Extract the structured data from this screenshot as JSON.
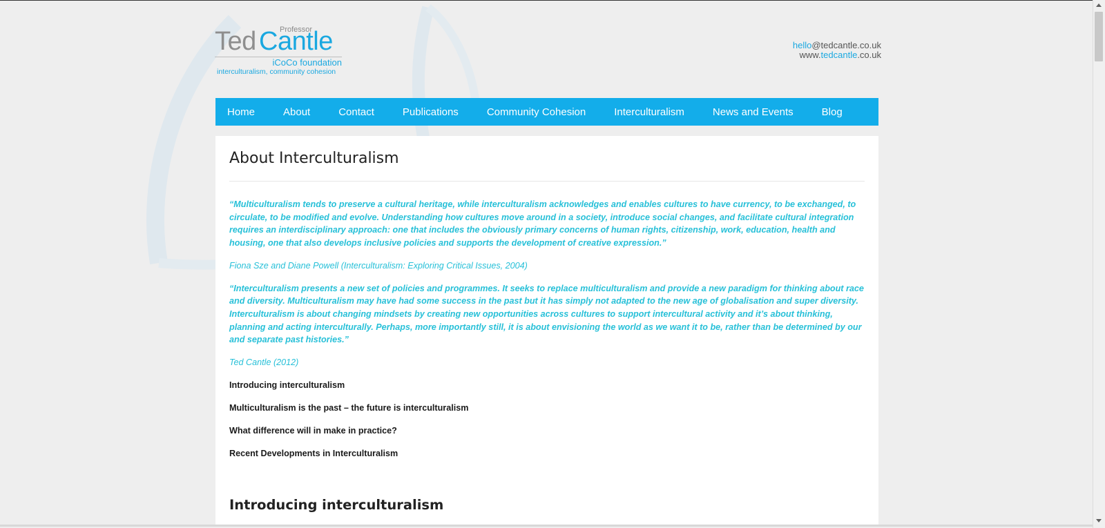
{
  "header": {
    "logo": {
      "professor": "Professor",
      "ted": "Ted",
      "cantle": "Cantle",
      "foundation": "iCoCo foundation",
      "tagline": "interculturalism, community cohesion"
    },
    "contact": {
      "email_user": "hello",
      "email_domain": "@tedcantle.co.uk",
      "web_prefix": "www.",
      "web_name": "tedcantle",
      "web_suffix": ".co.uk"
    }
  },
  "nav": {
    "items": [
      "Home",
      "About",
      "Contact",
      "Publications",
      "Community Cohesion",
      "Interculturalism",
      "News and Events",
      "Blog"
    ]
  },
  "main": {
    "title": "About Interculturalism",
    "quote1": "“Multiculturalism tends to preserve a cultural heritage, while interculturalism acknowledges and enables cultures to have currency, to be exchanged, to circulate, to be modified and evolve. Understanding how cultures move around in a society, introduce social changes, and facilitate cultural integration requires an interdisciplinary approach: one that includes the obviously primary concerns of human rights, citizenship, work, education, health and housing, one that also develops inclusive policies and supports the development of creative expression.”",
    "cite1": "Fiona Sze and Diane Powell (Interculturalism: Exploring Critical Issues, 2004)",
    "quote2": "“Interculturalism  presents a new set of policies and programmes. It seeks to replace  multiculturalism and provide a new paradigm for thinking about race and diversity. Multiculturalism may have had some success in the past but it has simply not adapted to the new age of globalisation and super diversity. Interculturalism is about changing mindsets by creating new opportunities across cultures to support intercultural activity and it’s about thinking, planning and acting interculturally. Perhaps, more importantly still, it is about envisioning the world as we want it to be, rather than be determined by our and separate past histories.”",
    "cite2": "Ted Cantle (2012)",
    "links": [
      "Introducing interculturalism",
      "Multiculturalism is the past – the future is interculturalism",
      "What difference will in make in practice?",
      "Recent Developments in Interculturalism"
    ],
    "section_title": "Introducing interculturalism"
  },
  "colors": {
    "accent": "#13adea",
    "quote": "#27c0d8",
    "background": "#eeeeee"
  }
}
